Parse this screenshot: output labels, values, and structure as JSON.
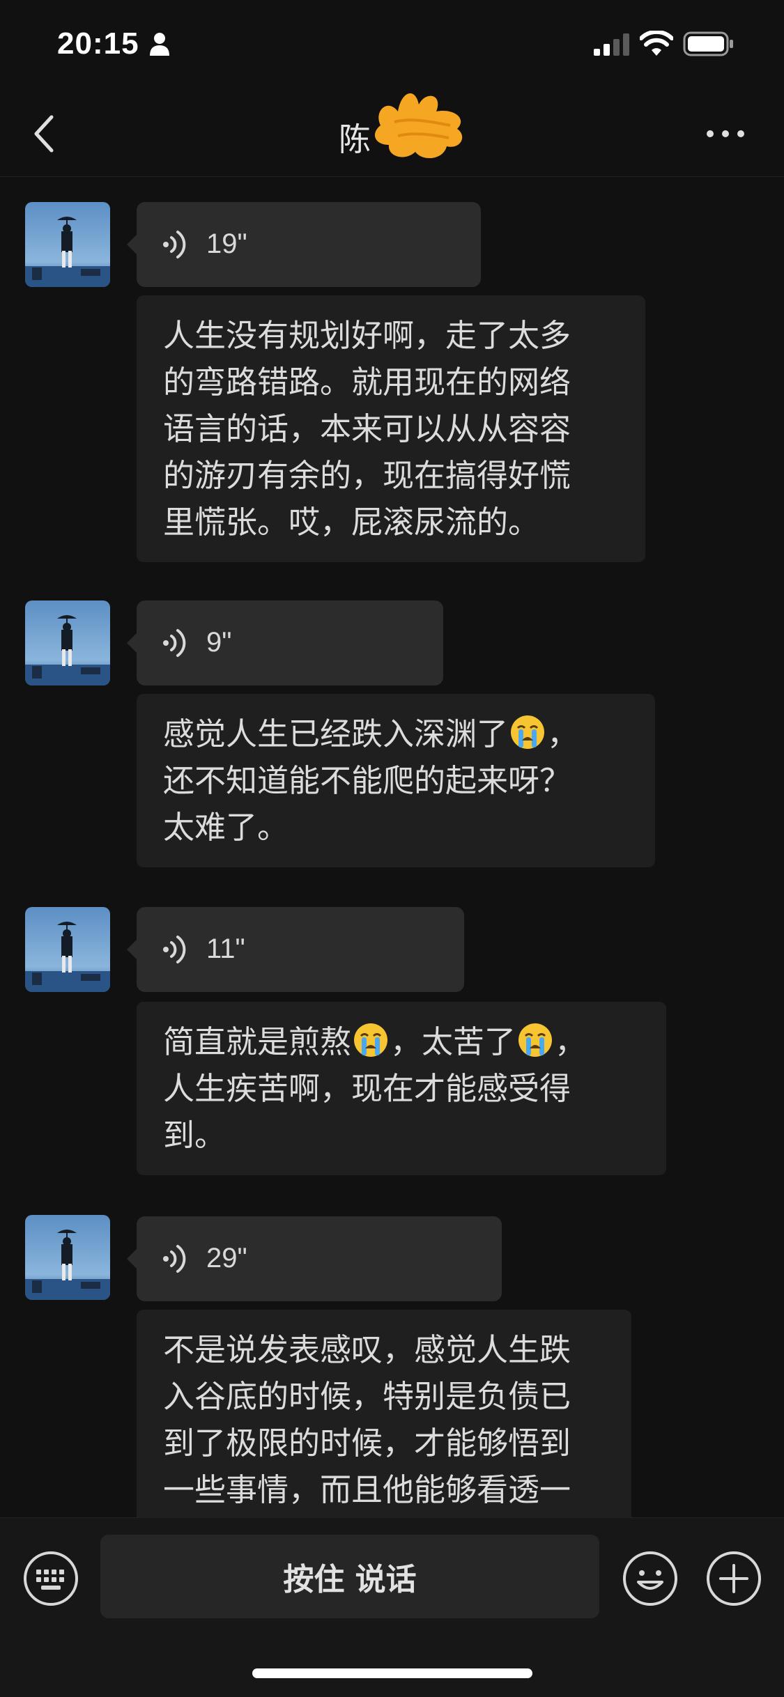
{
  "status_bar": {
    "time": "20:15"
  },
  "header": {
    "title": "陈"
  },
  "messages": [
    {
      "voice_duration": "19\"",
      "text": "人生没有规划好啊，走了太多\n的弯路错路。就用现在的网络\n语言的话，本来可以从从容容\n的游刃有余的，现在搞得好慌\n里慌张。哎，屁滚尿流的。"
    },
    {
      "voice_duration": "9\"",
      "text_a": "感觉人生已经跌入深渊了",
      "text_b": "，\n还不知道能不能爬的起来呀？\n太难了。",
      "emoji": "crying-face-icon"
    },
    {
      "voice_duration": "11\"",
      "text_a": "简直就是煎熬",
      "text_b": "，太苦了",
      "text_c": "，\n人生疾苦啊，现在才能感受得\n到。",
      "emoji": "crying-face-icon"
    },
    {
      "voice_duration": "29\"",
      "text": "不是说发表感叹，感觉人生跌\n入谷底的时候，特别是负债已\n到了极限的时候，才能够悟到\n一些事情，而且他能够看透一"
    }
  ],
  "input_bar": {
    "hold_to_talk_label": "按住 说话"
  },
  "colors": {
    "background": "#111111",
    "voice_bubble": "#2c2c2c",
    "text_bubble": "#1f1f1f",
    "censor": "#f5a623"
  }
}
